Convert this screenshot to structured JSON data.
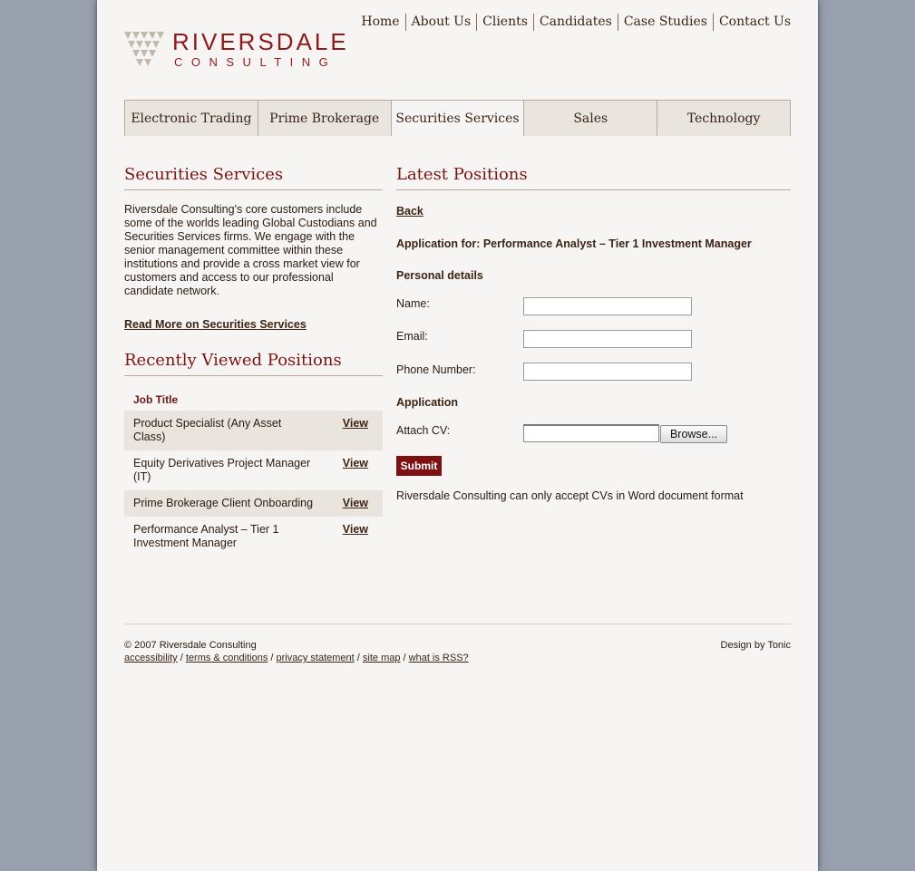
{
  "header": {
    "brand_name": "RIVERSDALE",
    "brand_sub": "CONSULTING",
    "nav": [
      "Home",
      "About Us",
      "Clients",
      "Candidates",
      "Case Studies",
      "Contact Us"
    ]
  },
  "tabs": [
    "Electronic Trading",
    "Prime Brokerage",
    "Securities Services",
    "Sales",
    "Technology"
  ],
  "active_tab": "Securities Services",
  "left": {
    "title": "Securities Services",
    "intro": "Riversdale Consulting's core customers include some of the worlds leading Global Custodians and Securities Services firms. We engage with the senior management committee within these institutions and provide a cross market view for customers and access to our professional candidate network.",
    "read_more": "Read More on Securities Services",
    "recent_title": "Recently Viewed Positions",
    "table_header": "Job Title",
    "positions": [
      {
        "title": "Product Specialist (Any Asset Class)",
        "action": "View"
      },
      {
        "title": "Equity Derivatives Project Manager (IT)",
        "action": "View"
      },
      {
        "title": "Prime Brokerage Client Onboarding",
        "action": "View"
      },
      {
        "title": "Performance Analyst – Tier 1 Investment Manager",
        "action": "View"
      }
    ]
  },
  "right": {
    "title": "Latest Positions",
    "back": "Back",
    "application_for": "Application for: Performance Analyst – Tier 1 Investment Manager",
    "personal_details": "Personal details",
    "name_label": "Name:",
    "email_label": "Email:",
    "phone_label": "Phone Number:",
    "application_heading": "Application",
    "attach_label": "Attach CV:",
    "browse": "Browse...",
    "submit": "Submit",
    "note": "Riversdale Consulting can only accept CVs in Word document format"
  },
  "footer": {
    "copyright": "© 2007 Riversdale Consulting",
    "links": [
      "accessibility",
      "terms & conditions",
      "privacy statement",
      "site map",
      "what is RSS?"
    ],
    "design_credit": "Design by Tonic"
  },
  "colors": {
    "outer_background": "#989fad",
    "page_background": "#f7f5f3",
    "brand_red": "#8e1a1a",
    "heading_red": "#7d1414",
    "tab_background": "#e9e4de",
    "submit_background": "#7d1010"
  }
}
